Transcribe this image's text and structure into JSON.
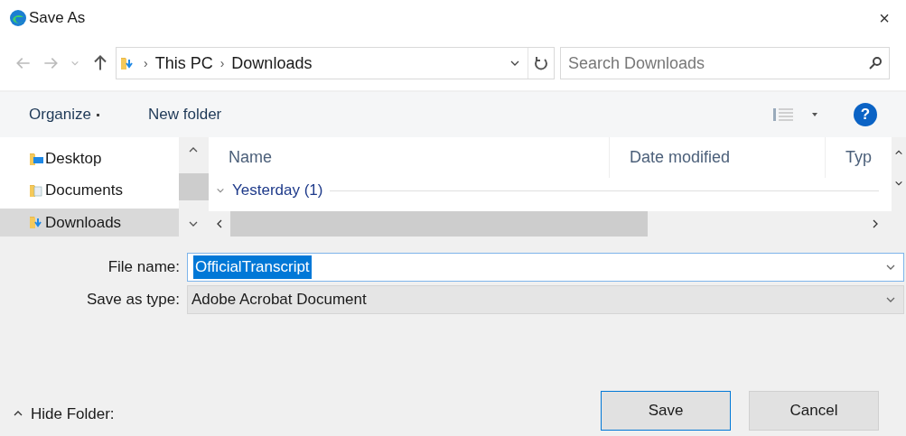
{
  "window": {
    "title": "Save As",
    "close": "×"
  },
  "address": {
    "path": [
      "This PC",
      "Downloads"
    ],
    "separator": "›"
  },
  "search": {
    "placeholder": "Search Downloads"
  },
  "toolbar": {
    "organize": "Organize",
    "new_folder": "New folder",
    "help": "?"
  },
  "sidebar": {
    "items": [
      {
        "label": "Desktop",
        "kind": "desktop",
        "selected": false
      },
      {
        "label": "Documents",
        "kind": "documents",
        "selected": false
      },
      {
        "label": "Downloads",
        "kind": "downloads",
        "selected": true
      }
    ]
  },
  "file_list": {
    "columns": [
      "Name",
      "Date modified",
      "Typ"
    ],
    "groups": [
      {
        "label": "Yesterday (1)",
        "expanded": true
      }
    ]
  },
  "form": {
    "file_name_label": "File name:",
    "file_name": "OfficialTranscript",
    "file_name_selected": true,
    "type_label": "Save as type:",
    "type": "Adobe Acrobat Document"
  },
  "hide_folder": "Hide Folder:",
  "buttons": [
    {
      "label": "Save",
      "default": true
    },
    {
      "label": "Cancel",
      "default": false
    }
  ]
}
